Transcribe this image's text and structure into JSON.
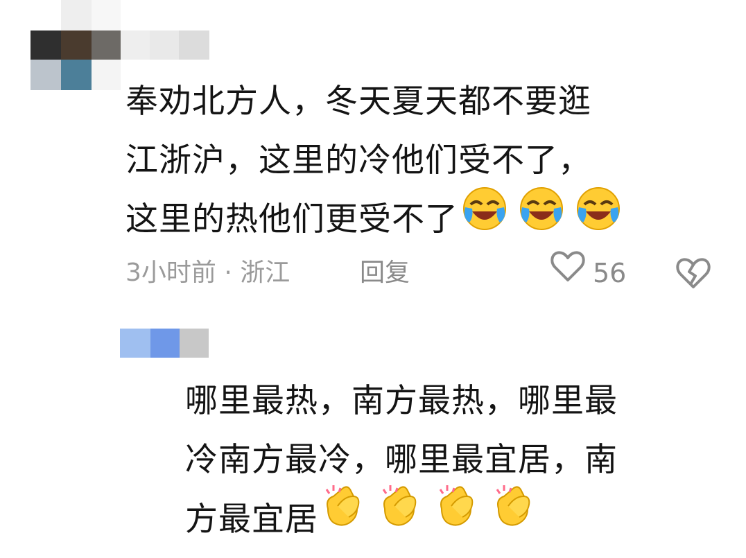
{
  "comment1": {
    "lines": [
      "奉劝北方人，冬天夏天都不要逛",
      "江浙沪，这里的冷他们受不了，",
      "这里的热他们更受不了"
    ],
    "emoji": "laughing-crying",
    "time": "3小时前",
    "separator": "·",
    "location": "浙江",
    "reply_label": "回复",
    "like_count": "56"
  },
  "comment2": {
    "lines": [
      "哪里最热，南方最热，哪里最",
      "冷南方最冷，哪里最宜居，南",
      "方最宜居"
    ],
    "emoji": "clapping-hands"
  },
  "colors": {
    "text": "#141414",
    "meta": "#9a9a9a",
    "icon": "#8a8a8a",
    "emoji_yellow": "#ffcc33"
  }
}
